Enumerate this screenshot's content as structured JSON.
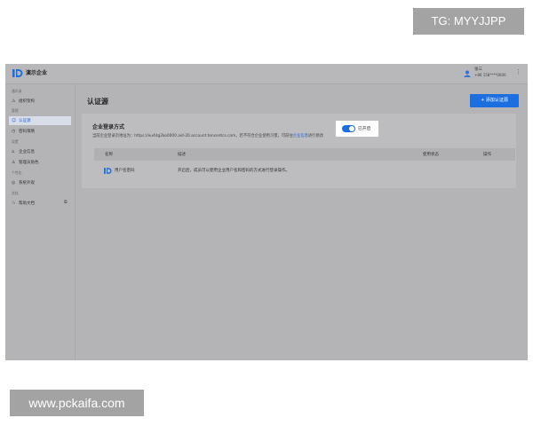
{
  "watermarks": {
    "top": "TG: MYYJJPP",
    "bottom": "www.pckaifa.com"
  },
  "header": {
    "company": "演示企业",
    "user_name": "张三",
    "user_phone": "+86 158****0000",
    "more_icon": "⋮"
  },
  "sidebar": {
    "groups": [
      "通讯录",
      "管理",
      "设置",
      "个性化",
      "文档"
    ],
    "items": [
      {
        "label": "组织架构",
        "icon": "org-icon",
        "glyph": "⚠"
      },
      {
        "label": "认证源",
        "icon": "auth-source-icon",
        "glyph": "☺"
      },
      {
        "label": "密码策略",
        "icon": "password-policy-icon",
        "glyph": "◷"
      },
      {
        "label": "企业信息",
        "icon": "enterprise-info-icon",
        "glyph": "⌂"
      },
      {
        "label": "管理员角色",
        "icon": "admin-role-icon",
        "glyph": "♙"
      },
      {
        "label": "系统外观",
        "icon": "appearance-icon",
        "glyph": "◎"
      },
      {
        "label": "帮助文档",
        "icon": "help-doc-icon",
        "glyph": "♘"
      }
    ],
    "external_icon": "⧉"
  },
  "main": {
    "title": "认证源",
    "add_button": "+ 添加认证源",
    "card": {
      "title": "企业登录方式",
      "desc_prefix": "当前企业登录页地址为：https://eu4dg2ko0000.aid-20.account.tencentcs.com，若不符合企业使用习惯，可前往",
      "desc_link": "企业信息",
      "desc_suffix": "进行修改"
    },
    "table": {
      "headers": [
        "名称",
        "描述",
        "使用状态",
        "操作"
      ],
      "rows": [
        {
          "name": "用户名密码",
          "description": "开启后，成员可以使用企业用户名和密码的方式进行登录操作。",
          "status": "已开启",
          "enabled": true
        }
      ]
    }
  },
  "colors": {
    "accent": "#1d6fe0",
    "overlay": "#b4b4b6"
  }
}
